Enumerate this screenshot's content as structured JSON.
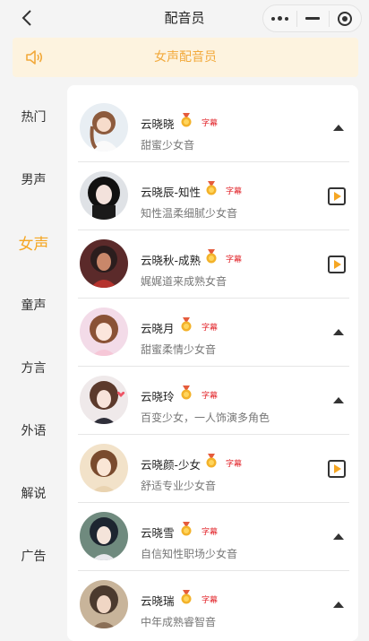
{
  "nav": {
    "title": "配音员"
  },
  "banner": {
    "text": "女声配音员"
  },
  "sidebar": {
    "items": [
      {
        "label": "热门",
        "active": false
      },
      {
        "label": "男声",
        "active": false
      },
      {
        "label": "女声",
        "active": true
      },
      {
        "label": "童声",
        "active": false
      },
      {
        "label": "方言",
        "active": false
      },
      {
        "label": "外语",
        "active": false
      },
      {
        "label": "解说",
        "active": false
      },
      {
        "label": "广告",
        "active": false
      }
    ]
  },
  "voices": [
    {
      "name": "云晓晓",
      "tag": "字幕",
      "desc": "甜蜜少女音",
      "control": "collapse"
    },
    {
      "name": "云晓辰-知性",
      "tag": "字幕",
      "desc": "知性温柔细腻少女音",
      "control": "play"
    },
    {
      "name": "云晓秋-成熟",
      "tag": "字幕",
      "desc": "娓娓道来成熟女音",
      "control": "play"
    },
    {
      "name": "云晓月",
      "tag": "字幕",
      "desc": "甜蜜柔情少女音",
      "control": "collapse"
    },
    {
      "name": "云晓玲",
      "tag": "字幕",
      "desc": "百变少女，一人饰演多角色",
      "control": "collapse"
    },
    {
      "name": "云晓颜-少女",
      "tag": "字幕",
      "desc": "舒适专业少女音",
      "control": "play"
    },
    {
      "name": "云晓雪",
      "tag": "字幕",
      "desc": "自信知性职场少女音",
      "control": "collapse"
    },
    {
      "name": "云晓瑞",
      "tag": "字幕",
      "desc": "中年成熟睿智音",
      "control": "collapse"
    }
  ],
  "colors": {
    "accent": "#f5a623",
    "tag": "#e2242a",
    "banner_bg": "#fdf3df"
  }
}
